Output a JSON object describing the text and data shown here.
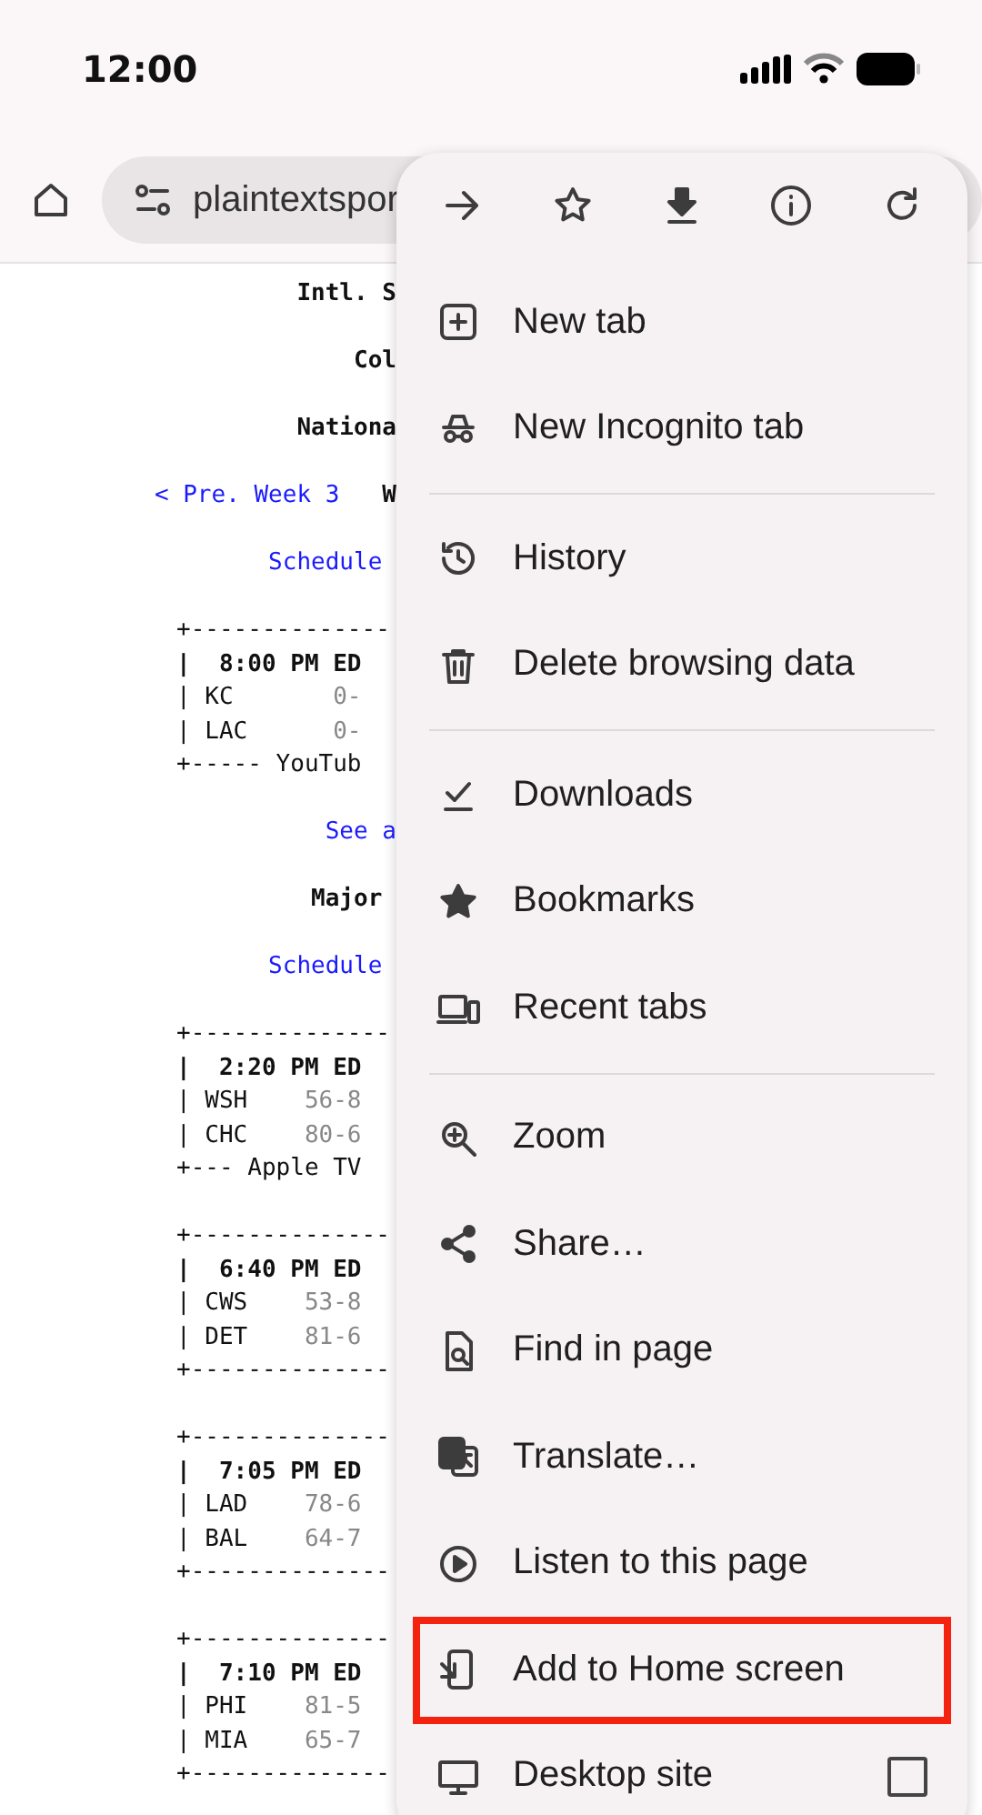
{
  "status_bar": {
    "time": "12:00"
  },
  "toolbar": {
    "url": "plaintextspor"
  },
  "page": {
    "items": [
      {
        "kind": "heading",
        "text": "Intl. S"
      },
      {
        "kind": "heading",
        "text": "Col"
      },
      {
        "kind": "heading",
        "text": "Nationa"
      },
      {
        "kind": "nav",
        "link": "< Pre. Week 3",
        "text": "W"
      },
      {
        "kind": "link",
        "text": "Schedule "
      },
      {
        "kind": "game",
        "top": "+--------------",
        "time": "|  8:00 PM ED",
        "teams": [
          {
            "name": "| KC       ",
            "record": "0-"
          },
          {
            "name": "| LAC      ",
            "record": "0-"
          }
        ],
        "bottom": "+----- YouTub"
      },
      {
        "kind": "link",
        "text": "See a"
      },
      {
        "kind": "heading",
        "text": "Major "
      },
      {
        "kind": "link",
        "text": "Schedule "
      },
      {
        "kind": "game",
        "top": "+--------------",
        "time": "|  2:20 PM ED",
        "teams": [
          {
            "name": "| WSH    ",
            "record": "56-8"
          },
          {
            "name": "| CHC    ",
            "record": "80-6"
          }
        ],
        "bottom": "+--- Apple TV"
      },
      {
        "kind": "game",
        "top": "+--------------",
        "time": "|  6:40 PM ED",
        "teams": [
          {
            "name": "| CWS    ",
            "record": "53-8"
          },
          {
            "name": "| DET    ",
            "record": "81-6"
          }
        ],
        "bottom": "+--------------"
      },
      {
        "kind": "game",
        "top": "+--------------",
        "time": "|  7:05 PM ED",
        "teams": [
          {
            "name": "| LAD    ",
            "record": "78-6"
          },
          {
            "name": "| BAL    ",
            "record": "64-7"
          }
        ],
        "bottom": "+--------------"
      },
      {
        "kind": "game",
        "top": "+--------------",
        "time": "|  7:10 PM ED",
        "teams": [
          {
            "name": "| PHI    ",
            "record": "81-5"
          },
          {
            "name": "| MIA    ",
            "record": "65-7"
          }
        ],
        "bottom": "+--------------"
      }
    ]
  },
  "menu": {
    "groups": [
      [
        {
          "label": "New tab",
          "highlighted": false
        },
        {
          "label": "New Incognito tab",
          "highlighted": false
        }
      ],
      [
        {
          "label": "History",
          "highlighted": false
        },
        {
          "label": "Delete browsing data",
          "highlighted": false
        }
      ],
      [
        {
          "label": "Downloads",
          "highlighted": false
        },
        {
          "label": "Bookmarks",
          "highlighted": false
        },
        {
          "label": "Recent tabs",
          "highlighted": false
        }
      ],
      [
        {
          "label": "Zoom",
          "highlighted": false
        },
        {
          "label": "Share…",
          "highlighted": false
        },
        {
          "label": "Find in page",
          "highlighted": false
        },
        {
          "label": "Translate…",
          "highlighted": false
        },
        {
          "label": "Listen to this page",
          "highlighted": false
        },
        {
          "label": "Add to Home screen",
          "highlighted": true
        },
        {
          "label": "Desktop site",
          "highlighted": false,
          "checked": false
        }
      ]
    ]
  }
}
